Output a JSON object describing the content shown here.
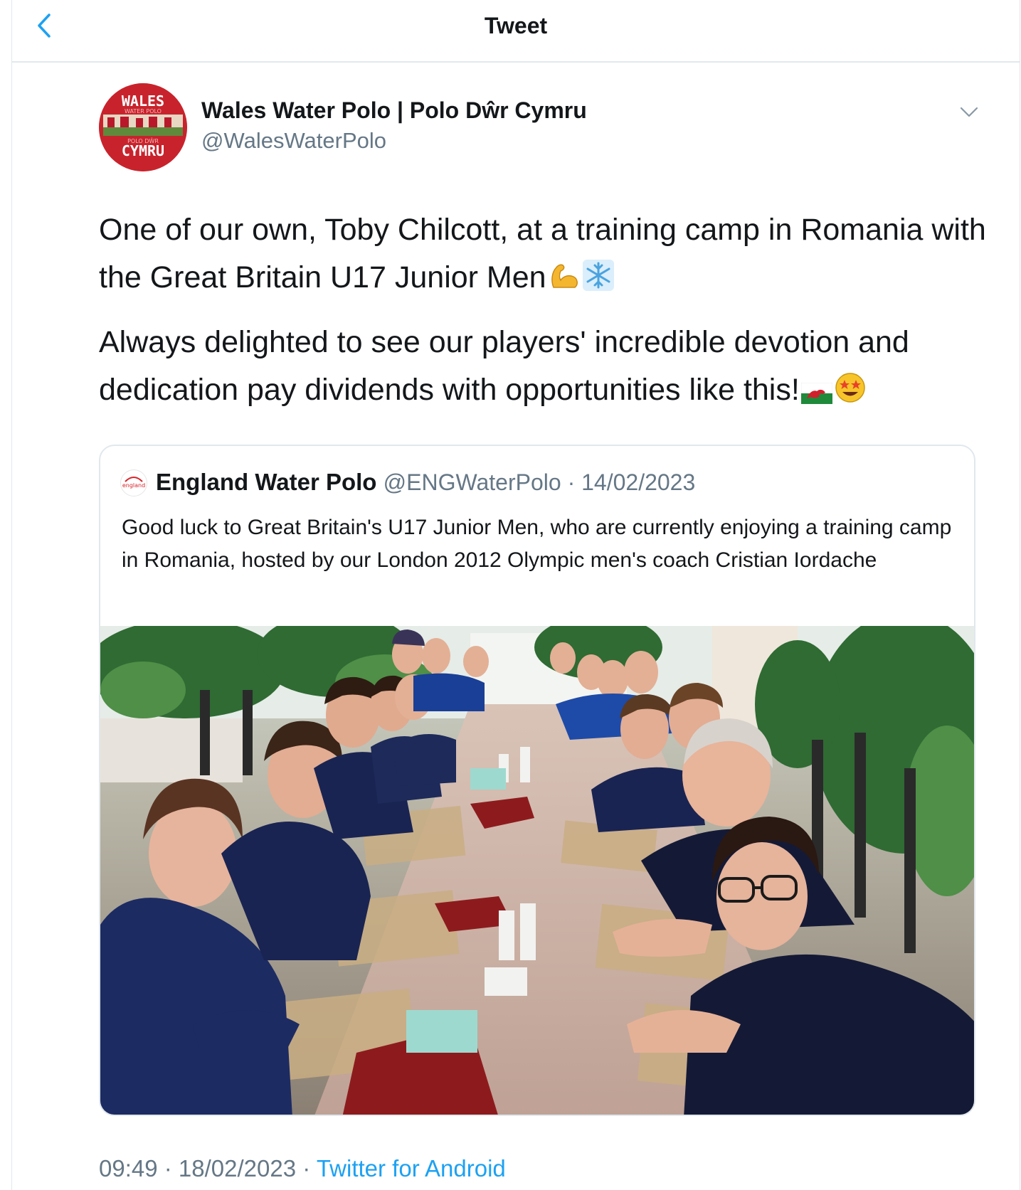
{
  "header": {
    "title": "Tweet",
    "back_icon": "chevron-left-icon"
  },
  "colors": {
    "accent": "#1da1f2",
    "secondary_text": "#657786",
    "primary_text": "#14171a",
    "divider": "#e1e8ed"
  },
  "author": {
    "name": "Wales Water Polo | Polo Dŵr Cymru",
    "handle": "@WalesWaterPolo",
    "avatar_text_top": "WALES",
    "avatar_text_mid": "WATER POLO",
    "avatar_text_mid2": "POLO DŴR",
    "avatar_text_bottom": "CYMRU"
  },
  "tweet": {
    "paragraph1": "One of our own, Toby Chilcott, at a training camp in Romania with the Great Britain U17 Junior Men",
    "paragraph1_emojis": [
      "flexed-biceps-icon",
      "snowflake-icon"
    ],
    "paragraph2": "Always delighted to see our players' incredible devotion and dedication pay dividends with opportunities like this!",
    "paragraph2_emojis": [
      "wales-flag-icon",
      "star-struck-icon"
    ]
  },
  "quoted": {
    "avatar_text": "england",
    "name": "England Water Polo",
    "handle": "@ENGWaterPolo",
    "separator": " · ",
    "date": "14/02/2023",
    "text": "Good luck to Great Britain's U17 Junior Men, who are currently enjoying a training camp in Romania, hosted by our London 2012 Olympic men's coach Cristian Iordache"
  },
  "meta": {
    "time": "09:49",
    "sep1": " · ",
    "date": "18/02/2023",
    "sep2": " · ",
    "source": "Twitter for Android"
  }
}
